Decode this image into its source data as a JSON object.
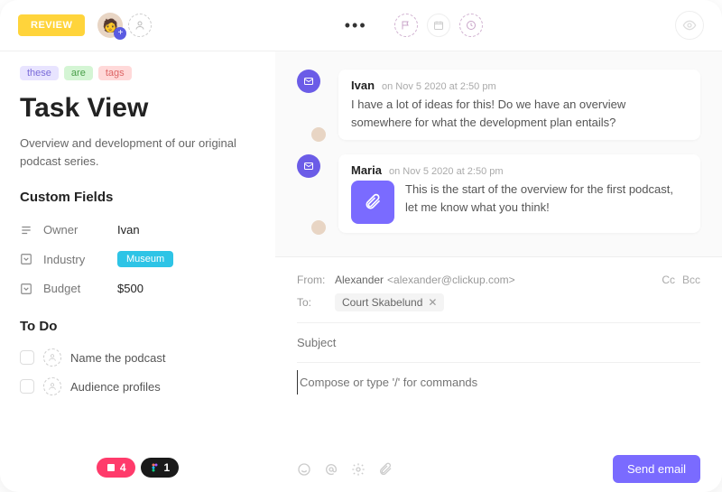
{
  "topbar": {
    "review_label": "REVIEW"
  },
  "left": {
    "tags": [
      "these",
      "are",
      "tags"
    ],
    "title": "Task View",
    "desc": "Overview and development of our original podcast series.",
    "custom_fields_h": "Custom Fields",
    "fields": {
      "owner_label": "Owner",
      "owner_value": "Ivan",
      "industry_label": "Industry",
      "industry_value": "Museum",
      "budget_label": "Budget",
      "budget_value": "$500"
    },
    "todo_h": "To Do",
    "todos": [
      "Name the podcast",
      "Audience profiles"
    ],
    "pill_red_count": "4",
    "pill_dark_count": "1"
  },
  "comments": [
    {
      "name": "Ivan",
      "time": "on Nov 5 2020 at 2:50 pm",
      "text": "I have a lot of ideas for this! Do we have an overview somewhere for what the development plan entails?"
    },
    {
      "name": "Maria",
      "time": "on Nov 5 2020 at 2:50 pm",
      "text": "This is the start of the overview for the first podcast, let me know what you think!"
    }
  ],
  "composer": {
    "from_label": "From:",
    "from_name": "Alexander",
    "from_email": "<alexander@clickup.com>",
    "to_label": "To:",
    "to_chip": "Court Skabelund",
    "cc": "Cc",
    "bcc": "Bcc",
    "subject_placeholder": "Subject",
    "body_placeholder": "Compose or type '/' for commands",
    "send_label": "Send email"
  }
}
